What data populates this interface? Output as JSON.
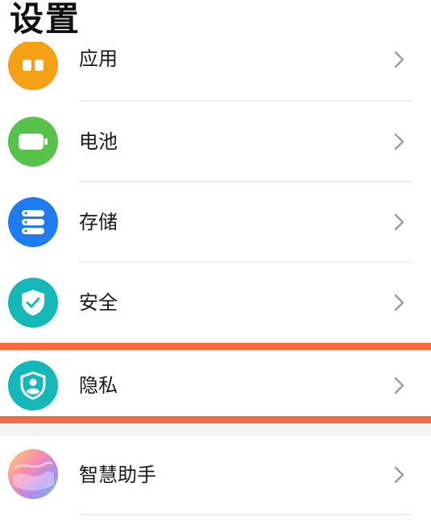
{
  "header": {
    "title": "设置"
  },
  "items": [
    {
      "label": "应用",
      "icon": "apps-icon",
      "color": "#f5a015"
    },
    {
      "label": "电池",
      "icon": "battery-icon",
      "color": "#57c24a"
    },
    {
      "label": "存储",
      "icon": "storage-icon",
      "color": "#1f7bf0"
    },
    {
      "label": "安全",
      "icon": "shield-check-icon",
      "color": "#15b8b8"
    },
    {
      "label": "隐私",
      "icon": "privacy-icon",
      "color": "#15b8b8"
    },
    {
      "label": "智慧助手",
      "icon": "assistant-icon",
      "color": "gradient"
    }
  ],
  "colors": {
    "highlight": "#f26b43",
    "chevron": "#9a9a9a",
    "divider": "#e4e4e4"
  }
}
